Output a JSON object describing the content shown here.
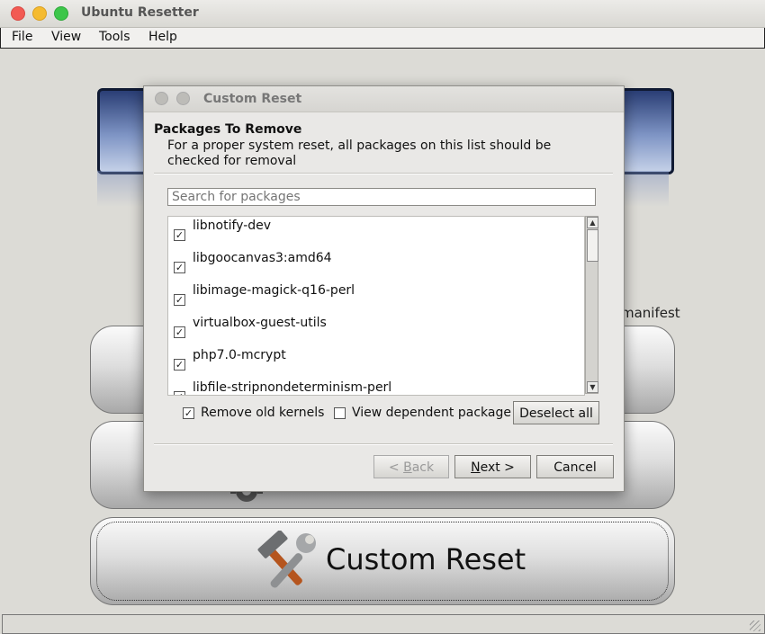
{
  "window": {
    "title": "Ubuntu Resetter"
  },
  "menu": [
    "File",
    "View",
    "Tools",
    "Help"
  ],
  "background": {
    "partial_text": "manifest",
    "custom_reset_label": "Custom Reset"
  },
  "dialog": {
    "title": "Custom Reset",
    "section_title": "Packages To Remove",
    "description": "For a proper system reset, all packages on this list should be checked for removal",
    "search_placeholder": "Search for packages",
    "packages": [
      {
        "name": "libnotify-dev",
        "checked": true
      },
      {
        "name": "libgoocanvas3:amd64",
        "checked": true
      },
      {
        "name": "libimage-magick-q16-perl",
        "checked": true
      },
      {
        "name": "virtualbox-guest-utils",
        "checked": true
      },
      {
        "name": "php7.0-mcrypt",
        "checked": true
      },
      {
        "name": "libfile-stripnondeterminism-perl",
        "checked": true
      }
    ],
    "remove_old_kernels": {
      "label": "Remove old kernels",
      "checked": true
    },
    "view_dependent": {
      "label": "View dependent package",
      "checked": false
    },
    "deselect_all": "Deselect all",
    "back": {
      "prefix": "< ",
      "mnemonic": "B",
      "rest": "ack"
    },
    "next": {
      "mnemonic": "N",
      "rest": "ext >"
    },
    "cancel": "Cancel"
  },
  "icons": [
    "gear-icon",
    "tools-icon",
    "scroll-up-icon",
    "scroll-down-icon",
    "checkmark-icon"
  ]
}
